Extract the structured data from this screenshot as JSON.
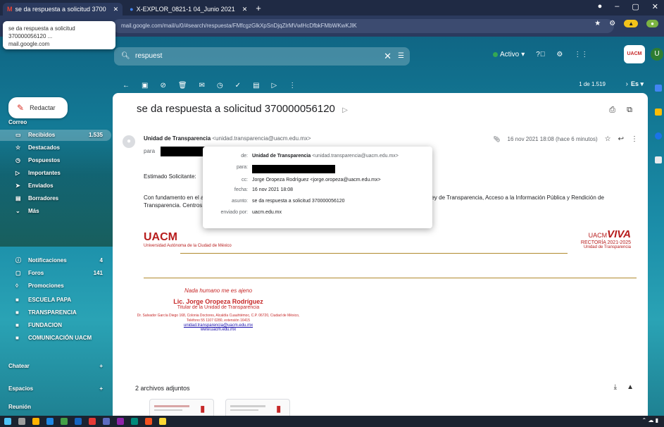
{
  "browser": {
    "tabs": [
      {
        "label": "se da respuesta a solicitud 3700"
      },
      {
        "label": "X-EXPLOR_0821-1 04_Junio 2021"
      }
    ],
    "url": "mail.google.com/mail/u/0/#search/respuesta/FMfcgzGlkXpSnDjqZlrMVwlHcDfbkFMbWKwKJlK",
    "tooltip": {
      "title": "se da respuesta a solicitud",
      "number": "370000056120 ...",
      "domain": "mail.google.com"
    }
  },
  "gmail": {
    "search": {
      "value": "respuest"
    },
    "active_status": "Activo",
    "avatar_letter": "U",
    "app_logo": "UACM"
  },
  "sidebar": {
    "compose": "Redactar",
    "section_mail": "Correo",
    "items": [
      {
        "label": "Recibidos",
        "count": "1.535"
      },
      {
        "label": "Destacados"
      },
      {
        "label": "Pospuestos"
      },
      {
        "label": "Importantes"
      },
      {
        "label": "Enviados"
      },
      {
        "label": "Borradores"
      },
      {
        "label": "Más"
      },
      {
        "label": "Notificaciones",
        "count": "4"
      },
      {
        "label": "Foros",
        "count": "141"
      },
      {
        "label": "Promociones"
      },
      {
        "label": "ESCUELA PAPA"
      },
      {
        "label": "TRANSPARENCIA"
      },
      {
        "label": "FUNDACION"
      },
      {
        "label": "COMUNICACIÓN UACM"
      }
    ],
    "section_chat": "Chatear",
    "section_spaces": "Espacios",
    "section_meet": "Reunión"
  },
  "toolbar": {
    "pager": "1 de 1.519",
    "lang": "Es"
  },
  "email": {
    "subject": "se da respuesta a solicitud 370000056120",
    "sender_name": "Unidad de Transparencia",
    "sender_email": "<unidad.transparencia@uacm.edu.mx>",
    "to_prefix": "para",
    "date": "16 nov 2021 18:08 (hace 6 minutos)",
    "greeting": "Estimado Solicitante:",
    "body_left": "Con fundamento en el artículo de la Ley de Transparencia. Centros de la Ciudad de México",
    "body_right": "Ley de Transparencia, Acceso a la Información Pública y Rendición de",
    "logo_uacm": "UACM",
    "logo_uacm_sub": "Universidad Autónoma de la Ciudad de México",
    "logo_viva_pre": "UACM",
    "logo_viva": "VIVA",
    "logo_viva_sub": "RECTORÍA 2021-2025",
    "logo_viva_unit": "Unidad de Transparencia",
    "signature": {
      "quote": "Nada humano me es ajeno",
      "name": "Lic. Jorge Oropeza Rodríguez",
      "title": "Titular de la Unidad de Transparencia",
      "address": "Dr. Salvador García Diego 168, Colonia Doctores, Alcaldía Cuauhtémoc, C.P. 06720, Ciudad de México, Teléfono 55 1107 0280, extensión 16415",
      "email_link": "unidad.transparencia@uacm.edu.mx",
      "web": "www.uacm.edu.mx"
    },
    "attachments_title": "2 archivos adjuntos"
  },
  "details_popup": {
    "rows": [
      {
        "key": "de:",
        "value_bold": "Unidad de Transparencia",
        "value": " <unidad.transparencia@uacm.edu.mx>"
      },
      {
        "key": "para:",
        "value": ""
      },
      {
        "key": "cc:",
        "value": "Jorge Oropeza Rodríguez <jorge.oropeza@uacm.edu.mx>"
      },
      {
        "key": "fecha:",
        "value": "16 nov 2021 18:08"
      },
      {
        "key": "asunto:",
        "value": "se da respuesta a solicitud 370000056120"
      },
      {
        "key": "enviado por:",
        "value": "uacm.edu.mx"
      }
    ]
  },
  "colors": {
    "accent_red": "#c62828",
    "link_blue": "#1a0dab",
    "title_bar": "#1f2a44"
  }
}
